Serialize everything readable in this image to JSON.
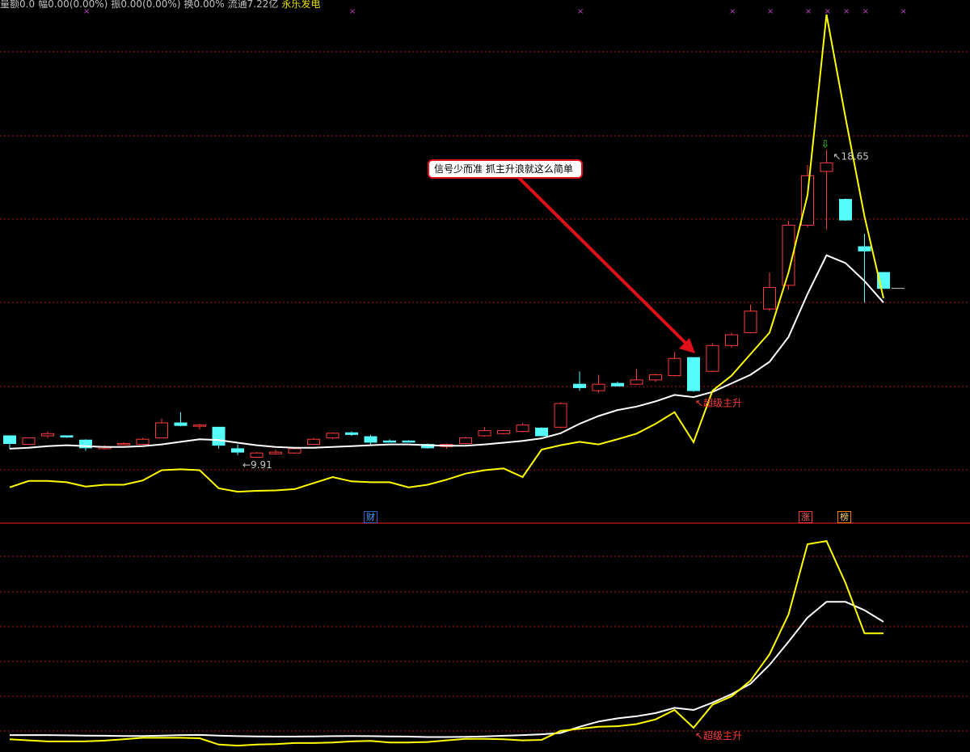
{
  "header": {
    "fields": [
      {
        "text": "量额0.0",
        "color": "#c0c0c0"
      },
      {
        "text": "幅0.00(0.00%)",
        "color": "#c0c0c0"
      },
      {
        "text": "振0.00(0.00%)",
        "color": "#c0c0c0"
      },
      {
        "text": "换0.00%",
        "color": "#c0c0c0"
      },
      {
        "text": "流通7.22亿",
        "color": "#c0c0c0"
      },
      {
        "text": "永乐发电",
        "color": "#e8e000"
      }
    ]
  },
  "callout": {
    "text": "信号少而准  抓主升浪就这么简单"
  },
  "badges": [
    {
      "text": "财",
      "color": "#4aa0ff",
      "border": "#3060c0"
    },
    {
      "text": "涨",
      "color": "#ff6060",
      "border": "#ff3030"
    },
    {
      "text": "榜",
      "color": "#ffd060",
      "border": "#ff8000"
    }
  ],
  "signal_label": "超级主升",
  "colors": {
    "up": "#ff3c3c",
    "down": "#54fcfc",
    "ma": "#ffffff",
    "yellow": "#ffff00",
    "grid": "#b01818",
    "divider": "#ff2020",
    "marker": "#c040c0",
    "arrow": "#e0101a"
  },
  "chart_data": [
    {
      "type": "candlestick",
      "name": "main",
      "annotations": [
        {
          "text": "9.91",
          "x": 12,
          "kind": "low"
        },
        {
          "text": "18.65",
          "x": 43,
          "kind": "high"
        },
        {
          "text": "超级主升",
          "x": 36,
          "kind": "signal"
        }
      ],
      "ohlc": [
        [
          12.0,
          12.0,
          11.7,
          11.82
        ],
        [
          11.8,
          11.95,
          11.8,
          11.95
        ],
        [
          12.0,
          12.1,
          11.95,
          12.05
        ],
        [
          12.0,
          12.0,
          11.95,
          11.98
        ],
        [
          11.9,
          11.92,
          11.65,
          11.72
        ],
        [
          11.7,
          11.78,
          11.68,
          11.75
        ],
        [
          11.82,
          11.85,
          11.78,
          11.82
        ],
        [
          11.8,
          11.95,
          11.8,
          11.92
        ],
        [
          11.95,
          12.4,
          11.95,
          12.3
        ],
        [
          12.3,
          12.55,
          12.22,
          12.24
        ],
        [
          12.24,
          12.28,
          12.15,
          12.25
        ],
        [
          12.2,
          12.2,
          11.7,
          11.78
        ],
        [
          11.7,
          11.8,
          11.55,
          11.62
        ],
        [
          11.5,
          11.62,
          11.48,
          11.6
        ],
        [
          11.58,
          11.68,
          11.56,
          11.62
        ],
        [
          11.6,
          11.72,
          11.58,
          11.7
        ],
        [
          11.8,
          11.95,
          11.78,
          11.92
        ],
        [
          11.95,
          12.08,
          11.92,
          12.06
        ],
        [
          12.07,
          12.1,
          12.0,
          12.03
        ],
        [
          11.98,
          12.02,
          11.8,
          11.85
        ],
        [
          11.88,
          11.92,
          11.85,
          11.87
        ],
        [
          11.88,
          11.9,
          11.86,
          11.86
        ],
        [
          11.8,
          11.82,
          11.7,
          11.72
        ],
        [
          11.75,
          11.82,
          11.7,
          11.8
        ],
        [
          11.82,
          11.98,
          11.8,
          11.95
        ],
        [
          12.0,
          12.2,
          11.98,
          12.12
        ],
        [
          12.05,
          12.14,
          12.03,
          12.12
        ],
        [
          12.1,
          12.3,
          12.08,
          12.25
        ],
        [
          12.18,
          12.2,
          12.0,
          12.0
        ],
        [
          12.2,
          12.78,
          12.18,
          12.75
        ],
        [
          13.2,
          13.5,
          13.05,
          13.12
        ],
        [
          13.05,
          13.42,
          13.0,
          13.2
        ],
        [
          13.22,
          13.26,
          13.15,
          13.16
        ],
        [
          13.2,
          13.55,
          13.18,
          13.3
        ],
        [
          13.3,
          13.45,
          13.25,
          13.42
        ],
        [
          13.4,
          13.95,
          13.38,
          13.8
        ],
        [
          13.82,
          13.82,
          13.02,
          13.05
        ],
        [
          13.5,
          14.15,
          13.48,
          14.1
        ],
        [
          14.1,
          14.4,
          14.05,
          14.35
        ],
        [
          14.4,
          15.05,
          14.38,
          14.9
        ],
        [
          14.95,
          15.8,
          14.9,
          15.45
        ],
        [
          15.5,
          17.0,
          15.4,
          16.9
        ],
        [
          16.9,
          18.3,
          16.85,
          18.05
        ],
        [
          18.15,
          18.65,
          16.8,
          18.35
        ],
        [
          17.5,
          17.52,
          17.0,
          17.02
        ],
        [
          16.4,
          16.7,
          15.1,
          16.3
        ],
        [
          15.8,
          15.8,
          15.42,
          15.43
        ]
      ],
      "ma": [
        11.7,
        11.72,
        11.76,
        11.78,
        11.76,
        11.74,
        11.74,
        11.76,
        11.8,
        11.86,
        11.92,
        11.9,
        11.84,
        11.78,
        11.74,
        11.72,
        11.72,
        11.74,
        11.76,
        11.78,
        11.8,
        11.8,
        11.78,
        11.77,
        11.77,
        11.8,
        11.84,
        11.88,
        11.94,
        12.06,
        12.28,
        12.46,
        12.6,
        12.68,
        12.8,
        12.95,
        12.9,
        13.02,
        13.22,
        13.42,
        13.72,
        14.3,
        15.3,
        16.2,
        16.02,
        15.6,
        15.1
      ],
      "yellow": [
        10.8,
        10.95,
        10.95,
        10.92,
        10.82,
        10.86,
        10.86,
        10.96,
        11.2,
        11.22,
        11.2,
        10.78,
        10.7,
        10.72,
        10.73,
        10.76,
        10.9,
        11.04,
        10.94,
        10.92,
        10.92,
        10.8,
        10.86,
        10.98,
        11.12,
        11.2,
        11.24,
        11.04,
        11.68,
        11.78,
        11.86,
        11.8,
        11.92,
        12.05,
        12.28,
        12.55,
        11.85,
        13.05,
        13.4,
        13.9,
        14.4,
        15.8,
        17.6,
        21.8,
        19.4,
        17.1,
        15.2
      ]
    },
    {
      "type": "line",
      "name": "sub",
      "x": [
        0,
        1,
        2,
        3,
        4,
        5,
        6,
        7,
        8,
        9,
        10,
        11,
        12,
        13,
        14,
        15,
        16,
        17,
        18,
        19,
        20,
        21,
        22,
        23,
        24,
        25,
        26,
        27,
        28,
        29,
        30,
        31,
        32,
        33,
        34,
        35,
        36,
        37,
        38,
        39,
        40,
        41,
        42,
        43,
        44,
        45,
        46
      ],
      "series": [
        {
          "color": "white",
          "values": [
            1.3,
            1.3,
            1.3,
            1.28,
            1.26,
            1.24,
            1.22,
            1.22,
            1.26,
            1.3,
            1.32,
            1.26,
            1.2,
            1.18,
            1.16,
            1.16,
            1.18,
            1.2,
            1.22,
            1.2,
            1.18,
            1.16,
            1.12,
            1.12,
            1.14,
            1.18,
            1.24,
            1.3,
            1.38,
            1.5,
            2.1,
            2.6,
            2.9,
            3.1,
            3.4,
            3.9,
            3.7,
            4.4,
            5.2,
            6.2,
            8.0,
            10.2,
            12.5,
            14.0,
            14.0,
            13.2,
            12.1
          ]
        },
        {
          "color": "yellow",
          "values": [
            0.9,
            0.8,
            0.7,
            0.7,
            0.72,
            0.78,
            0.9,
            1.05,
            1.05,
            1.05,
            1.0,
            0.4,
            0.3,
            0.4,
            0.45,
            0.55,
            0.55,
            0.6,
            0.7,
            0.75,
            0.6,
            0.6,
            0.65,
            0.8,
            0.95,
            0.95,
            0.9,
            0.8,
            0.85,
            1.7,
            1.9,
            2.1,
            2.15,
            2.35,
            2.8,
            3.7,
            2.0,
            4.2,
            5.0,
            6.5,
            9.0,
            12.8,
            19.5,
            19.8,
            15.8,
            11.0,
            11.0
          ]
        }
      ]
    }
  ]
}
